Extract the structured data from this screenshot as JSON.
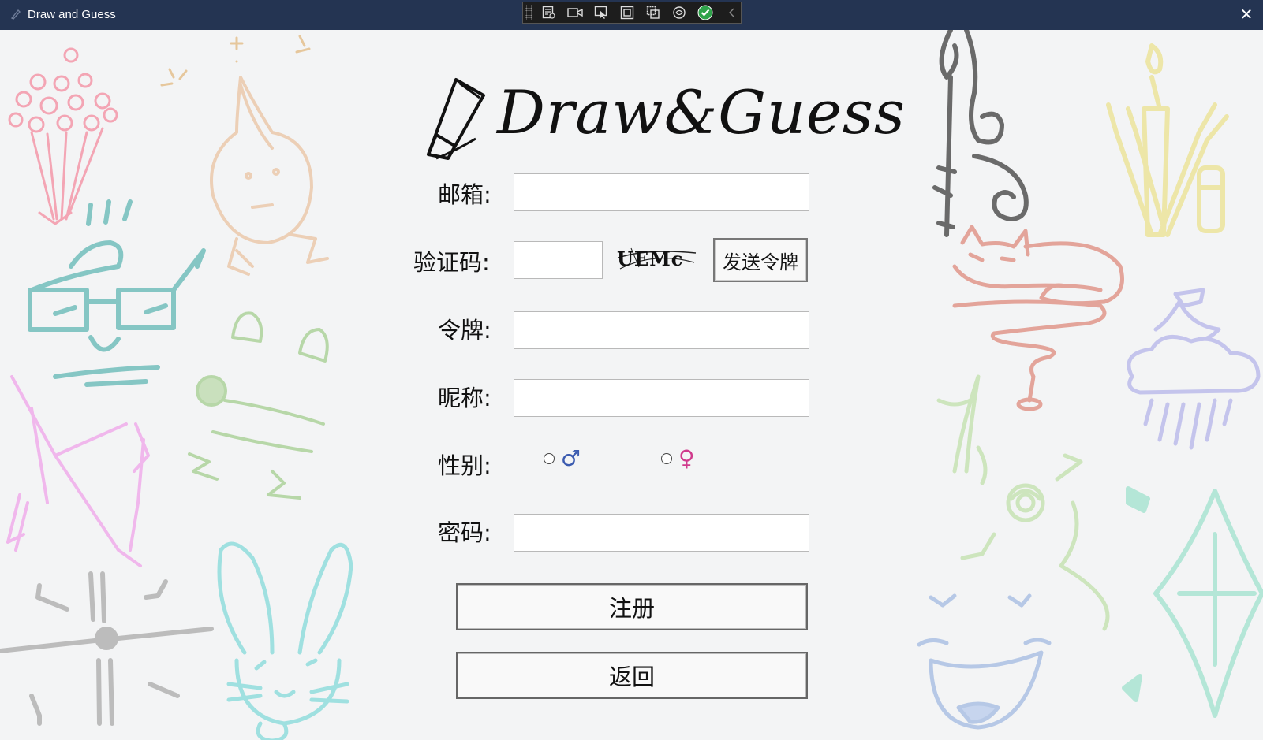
{
  "window": {
    "title": "Draw and Guess",
    "close_label": "✕"
  },
  "devtools": {
    "icons": [
      "live-tree-icon",
      "record-icon",
      "select-element-icon",
      "display-layout-adorners-icon",
      "track-focus-icon",
      "binding-failures-icon",
      "hot-reload-ok-icon",
      "collapse-icon"
    ]
  },
  "logo": {
    "text": "Draw&Guess"
  },
  "form": {
    "email_label": "邮箱:",
    "email_value": "",
    "code_label": "验证码:",
    "code_value": "",
    "captcha_text": "UEMc",
    "send_token_label": "发送令牌",
    "token_label": "令牌:",
    "token_value": "",
    "nickname_label": "昵称:",
    "nickname_value": "",
    "gender_label": "性别:",
    "gender_options": [
      {
        "symbol": "♂",
        "color": "#3b5bb0"
      },
      {
        "symbol": "♀",
        "color": "#d03a8c"
      }
    ],
    "password_label": "密码:",
    "password_value": ""
  },
  "actions": {
    "register_label": "注册",
    "back_label": "返回"
  }
}
